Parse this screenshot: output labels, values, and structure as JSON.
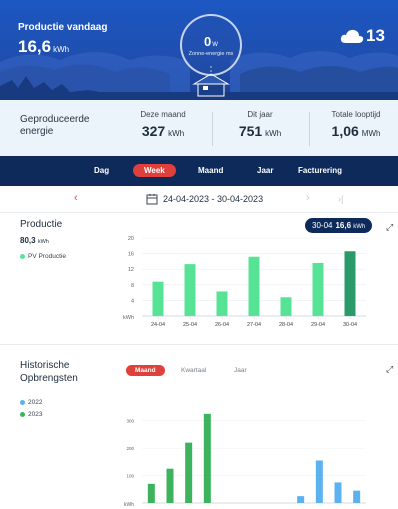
{
  "hero": {
    "title": "Productie vandaag",
    "value": "16,6",
    "unit": "kWh",
    "ring_value": "0",
    "ring_unit": "W",
    "ring_label": "Zonne-energie ms",
    "weather_temp": "13",
    "weather_icon": "cloud-icon"
  },
  "summary": {
    "label": "Geproduceerde energie",
    "month_label": "Deze maand",
    "month_value": "327",
    "month_unit": "kWh",
    "year_label": "Dit jaar",
    "year_value": "751",
    "year_unit": "kWh",
    "total_label": "Totale looptijd",
    "total_value": "1,06",
    "total_unit": "MWh"
  },
  "tabs": [
    "Dag",
    "Week",
    "Maand",
    "Jaar",
    "Facturering"
  ],
  "active_tab": "Week",
  "date_range": "24-04-2023 - 30-04-2023",
  "production": {
    "title": "Productie",
    "total_value": "80,3",
    "total_unit": "kWh",
    "legend": "PV Productie",
    "pill_date": "30-04",
    "pill_value": "16,6",
    "pill_unit": "kWh"
  },
  "history": {
    "title": "Historische Opbrengsten",
    "tabs": [
      "Maand",
      "Kwartaal",
      "Jaar"
    ],
    "active_tab": "Maand",
    "legend_2022": "2022",
    "legend_2023": "2023"
  },
  "colors": {
    "bar_light": "#57e396",
    "bar_selected": "#2a9a6a",
    "green_2023": "#3db35d",
    "blue_2022": "#5bb2ef",
    "accent": "#e0403c"
  },
  "chart_data": [
    {
      "type": "bar",
      "categories": [
        "24-04",
        "25-04",
        "26-04",
        "27-04",
        "28-04",
        "29-04",
        "30-04"
      ],
      "series": [
        {
          "name": "PV Productie",
          "values": [
            8.8,
            13.3,
            6.3,
            15.2,
            4.8,
            13.6,
            16.6
          ]
        }
      ],
      "ylabel": "kWh",
      "yticks": [
        4,
        8,
        12,
        16,
        20
      ],
      "ylim": [
        0,
        20
      ],
      "selected": "30-04"
    },
    {
      "type": "bar",
      "ylabel": "kWh",
      "yticks": [
        100,
        200,
        300
      ],
      "ylim": [
        0,
        350
      ],
      "series": [
        {
          "name": "2022",
          "values": [
            0,
            0,
            0,
            0,
            0,
            0,
            0,
            0,
            25,
            155,
            75,
            45
          ]
        },
        {
          "name": "2023",
          "values": [
            70,
            125,
            220,
            325,
            0,
            0,
            0,
            0,
            0,
            0,
            0,
            0
          ]
        }
      ]
    }
  ]
}
